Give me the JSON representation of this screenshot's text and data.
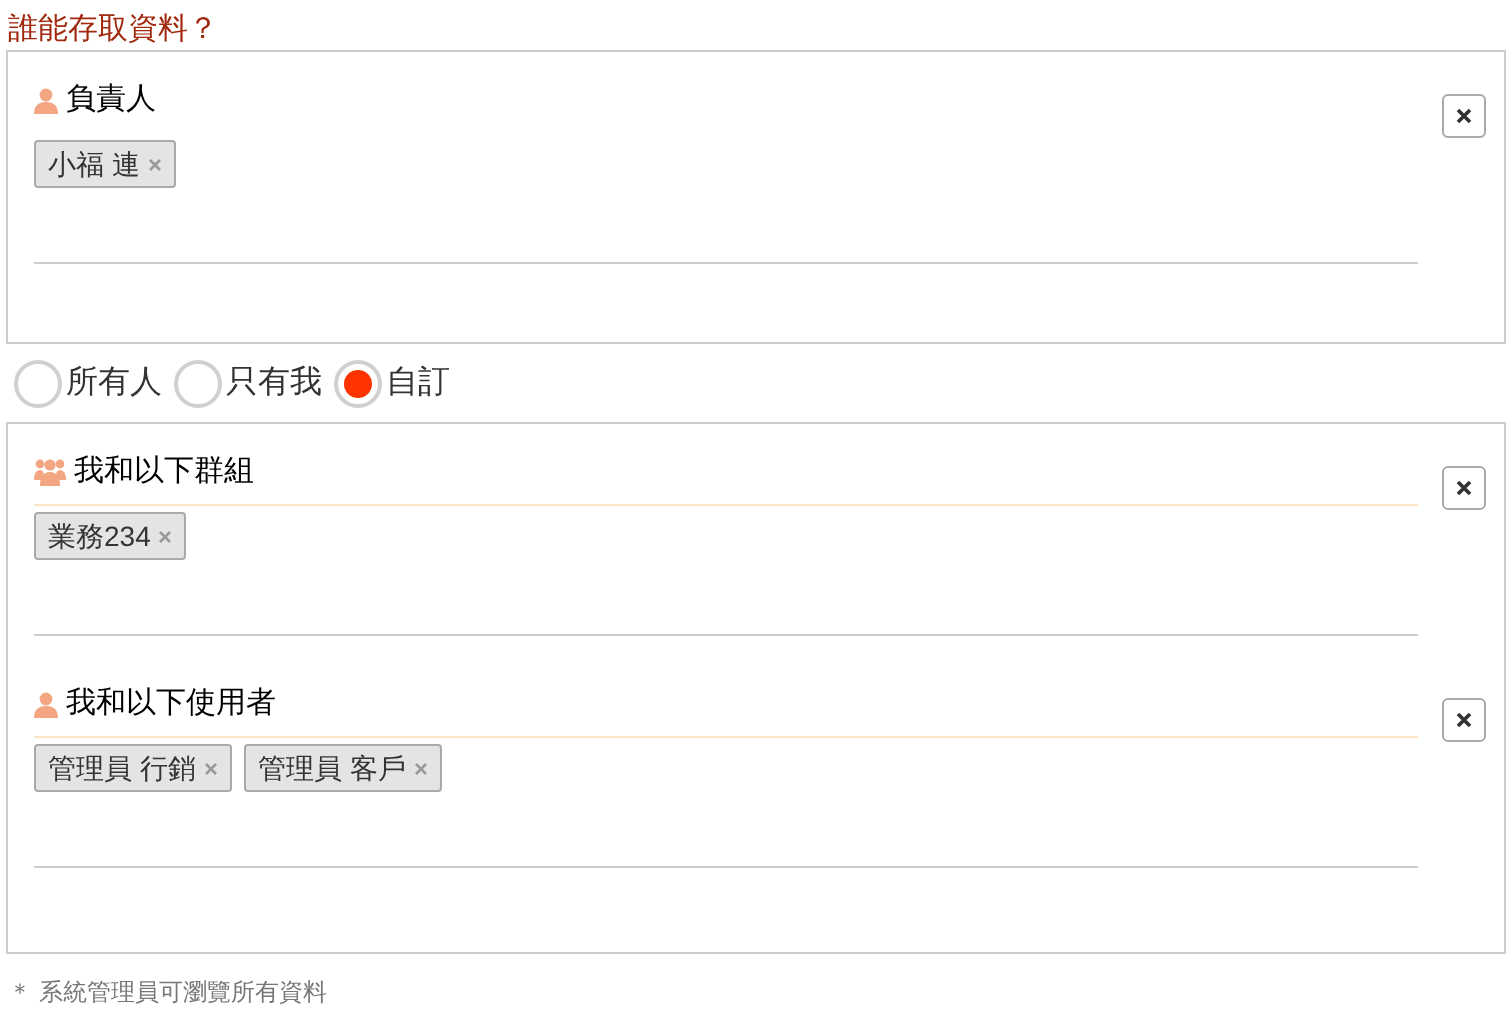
{
  "title": "誰能存取資料？",
  "owner": {
    "kind": "user",
    "label": "負責人",
    "tags": [
      "小福 連"
    ]
  },
  "options": [
    {
      "label": "所有人",
      "selected": false
    },
    {
      "label": "只有我",
      "selected": false
    },
    {
      "label": "自訂",
      "selected": true
    }
  ],
  "custom_sections": [
    {
      "kind": "group",
      "label": "我和以下群組",
      "tags": [
        "業務234"
      ]
    },
    {
      "kind": "user",
      "label": "我和以下使用者",
      "tags": [
        "管理員 行銷",
        "管理員 客戶"
      ]
    }
  ],
  "note": "＊ 系統管理員可瀏覽所有資料"
}
